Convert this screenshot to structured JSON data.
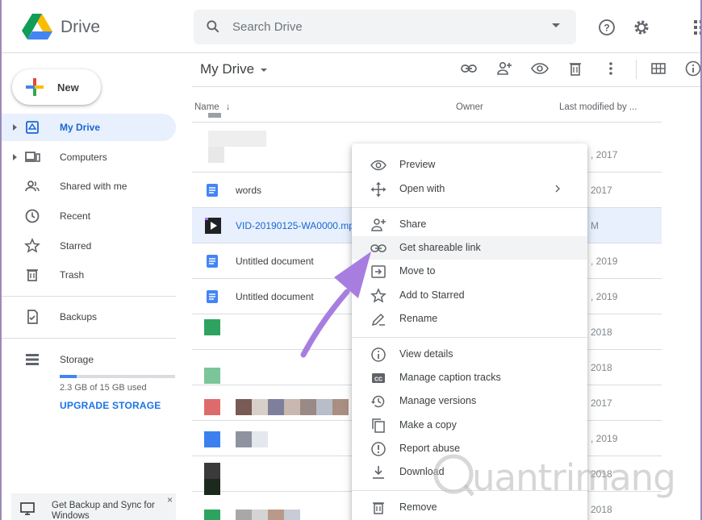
{
  "app": {
    "name": "Drive"
  },
  "search": {
    "placeholder": "Search Drive"
  },
  "header": {
    "help_icon": "help-icon",
    "settings_icon": "gear-icon",
    "apps_icon": "apps-grid-icon"
  },
  "new_button": {
    "label": "New"
  },
  "sidebar": {
    "items": [
      {
        "label": "My Drive",
        "icon": "my-drive-icon",
        "active": true
      },
      {
        "label": "Computers",
        "icon": "computers-icon"
      },
      {
        "label": "Shared with me",
        "icon": "shared-icon"
      },
      {
        "label": "Recent",
        "icon": "clock-icon"
      },
      {
        "label": "Starred",
        "icon": "star-icon"
      },
      {
        "label": "Trash",
        "icon": "trash-icon"
      },
      {
        "label": "Backups",
        "icon": "backup-icon"
      },
      {
        "label": "Storage",
        "icon": "storage-icon"
      }
    ],
    "storage": {
      "used_text": "2.3 GB of 15 GB used",
      "fraction": 0.15,
      "upgrade_label": "UPGRADE STORAGE"
    },
    "backup_banner": {
      "text": "Get Backup and Sync for Windows",
      "close": "×"
    }
  },
  "main": {
    "title": "My Drive",
    "columns": {
      "name": "Name",
      "owner": "Owner",
      "modified": "Last modified by ..."
    },
    "rows": [
      {
        "name": "",
        "date": ", 2017",
        "type": "blurred",
        "color": "#dadce0"
      },
      {
        "name": "words",
        "date": "2017",
        "type": "doc",
        "color": "#4285f4"
      },
      {
        "name": "VID-20190125-WA0000.mp",
        "date": "M",
        "type": "video",
        "color": "#202124",
        "selected": true
      },
      {
        "name": "Untitled document",
        "date": ", 2019",
        "type": "doc",
        "color": "#4285f4"
      },
      {
        "name": "Untitled document",
        "date": ", 2019",
        "type": "doc",
        "color": "#4285f4"
      },
      {
        "name": "",
        "date": "2018",
        "type": "blurred",
        "color": "#34a853"
      },
      {
        "name": "",
        "date": "2018",
        "type": "blurred",
        "color": "#81c995"
      },
      {
        "name": "",
        "date": "2017",
        "type": "blurred",
        "color": "#e06666"
      },
      {
        "name": "",
        "date": ", 2019",
        "type": "blurred",
        "color": "#4285f4"
      },
      {
        "name": "",
        "date": "2018",
        "type": "blurred",
        "color": "#202124"
      },
      {
        "name": "",
        "date": "2018",
        "type": "blurred",
        "color": "#34a853"
      }
    ]
  },
  "context_menu": {
    "items": [
      {
        "label": "Preview",
        "icon": "eye-icon"
      },
      {
        "label": "Open with",
        "icon": "move-arrows-icon",
        "submenu": true
      },
      {
        "label": "Share",
        "icon": "add-person-icon"
      },
      {
        "label": "Get shareable link",
        "icon": "link-icon",
        "highlighted": true
      },
      {
        "label": "Move to",
        "icon": "move-to-folder-icon"
      },
      {
        "label": "Add to Starred",
        "icon": "star-icon"
      },
      {
        "label": "Rename",
        "icon": "pencil-icon"
      },
      {
        "label": "View details",
        "icon": "info-icon"
      },
      {
        "label": "Manage caption tracks",
        "icon": "cc-icon"
      },
      {
        "label": "Manage versions",
        "icon": "history-icon"
      },
      {
        "label": "Make a copy",
        "icon": "copy-icon"
      },
      {
        "label": "Report abuse",
        "icon": "report-icon"
      },
      {
        "label": "Download",
        "icon": "download-icon"
      },
      {
        "label": "Remove",
        "icon": "trash-icon"
      }
    ]
  },
  "watermark": {
    "text": "uantrimang"
  },
  "colors": {
    "accent": "#1a73e8",
    "selected_bg": "#e8f0fe",
    "annotation_arrow": "#a77ee0"
  }
}
